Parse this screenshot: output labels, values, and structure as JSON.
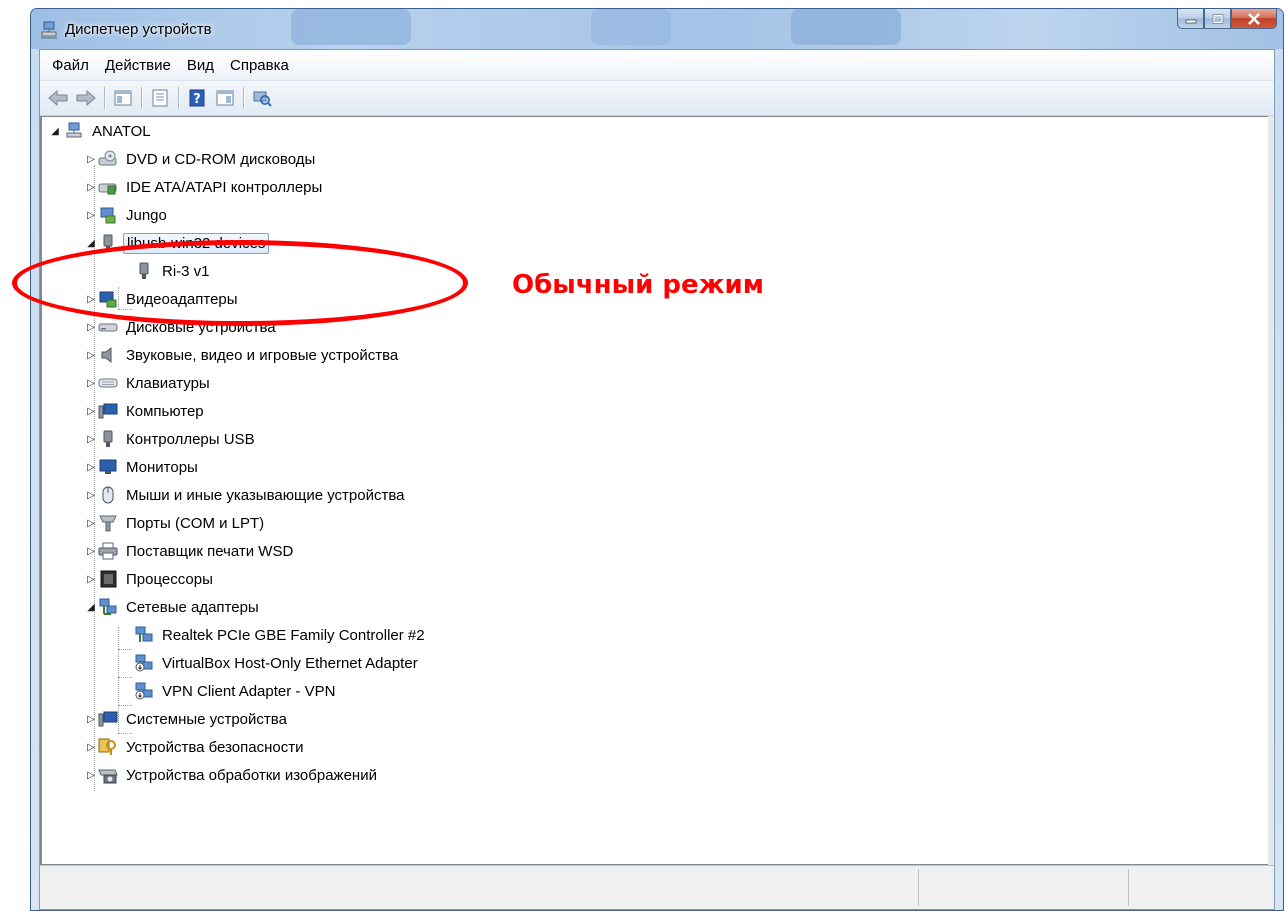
{
  "window": {
    "title": "Диспетчер устройств"
  },
  "menu": [
    {
      "label": "Файл"
    },
    {
      "label": "Действие"
    },
    {
      "label": "Вид"
    },
    {
      "label": "Справка"
    }
  ],
  "toolbar": {
    "icons": [
      "back-arrow-icon",
      "forward-arrow-icon",
      "show-hide-console-tree-icon",
      "properties-icon",
      "help-icon",
      "action-pane-icon",
      "scan-hardware-icon"
    ]
  },
  "tree": {
    "root": "ANATOL",
    "items": [
      {
        "label": "DVD и CD-ROM дисководы"
      },
      {
        "label": "IDE ATA/ATAPI контроллеры"
      },
      {
        "label": "Jungo"
      },
      {
        "label": "libusb-win32 devices"
      },
      {
        "label": "Ri-3 v1"
      },
      {
        "label": "Видеоадаптеры"
      },
      {
        "label": "Дисковые устройства"
      },
      {
        "label": "Звуковые, видео и игровые устройства"
      },
      {
        "label": "Клавиатуры"
      },
      {
        "label": "Компьютер"
      },
      {
        "label": "Контроллеры USB"
      },
      {
        "label": "Мониторы"
      },
      {
        "label": "Мыши и иные указывающие устройства"
      },
      {
        "label": "Порты (COM и LPT)"
      },
      {
        "label": "Поставщик печати WSD"
      },
      {
        "label": "Процессоры"
      },
      {
        "label": "Сетевые адаптеры"
      },
      {
        "label": "Realtek PCIe GBE Family Controller #2"
      },
      {
        "label": "VirtualBox Host-Only Ethernet Adapter"
      },
      {
        "label": "VPN Client Adapter - VPN"
      },
      {
        "label": "Системные устройства"
      },
      {
        "label": "Устройства безопасности"
      },
      {
        "label": "Устройства обработки изображений"
      }
    ]
  },
  "annotation": {
    "text": "Обычный режим",
    "color": "#ff0000"
  },
  "colors": {
    "selection": "#dcebfc",
    "annotation": "#ff0000"
  }
}
